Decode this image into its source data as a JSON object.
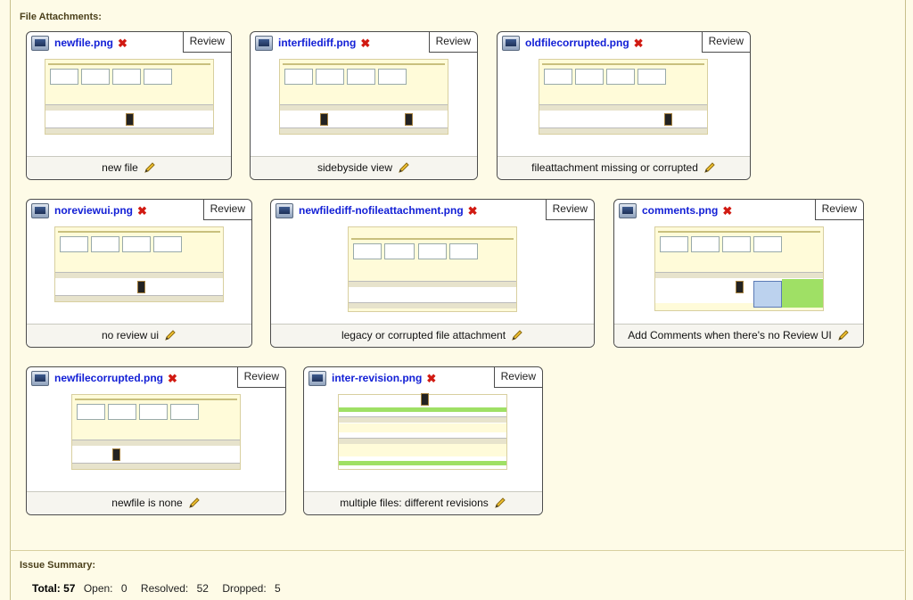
{
  "attachments_section": {
    "title": "File Attachments:"
  },
  "review_label": "Review",
  "attachments": [
    {
      "filename": "newfile.png",
      "caption": "new file"
    },
    {
      "filename": "interfilediff.png",
      "caption": "sidebyside view"
    },
    {
      "filename": "oldfilecorrupted.png",
      "caption": "fileattachment missing or corrupted"
    },
    {
      "filename": "noreviewui.png",
      "caption": "no review ui"
    },
    {
      "filename": "newfilediff-nofileattachment.png",
      "caption": "legacy or corrupted file attachment"
    },
    {
      "filename": "comments.png",
      "caption": "Add Comments when there's no Review UI"
    },
    {
      "filename": "newfilecorrupted.png",
      "caption": "newfile is none"
    },
    {
      "filename": "inter-revision.png",
      "caption": "multiple files: different revisions"
    }
  ],
  "issue_summary": {
    "title": "Issue Summary:",
    "total_label": "Total:",
    "total": "57",
    "open_label": "Open:",
    "open": "0",
    "resolved_label": "Resolved:",
    "resolved": "52",
    "dropped_label": "Dropped:",
    "dropped": "5"
  },
  "colors": {
    "link": "#1320d6",
    "delete": "#d11a12",
    "background": "#fefbe7"
  },
  "icons": {
    "file": "image-file-icon",
    "delete": "delete-x-icon",
    "edit": "pencil-icon"
  }
}
